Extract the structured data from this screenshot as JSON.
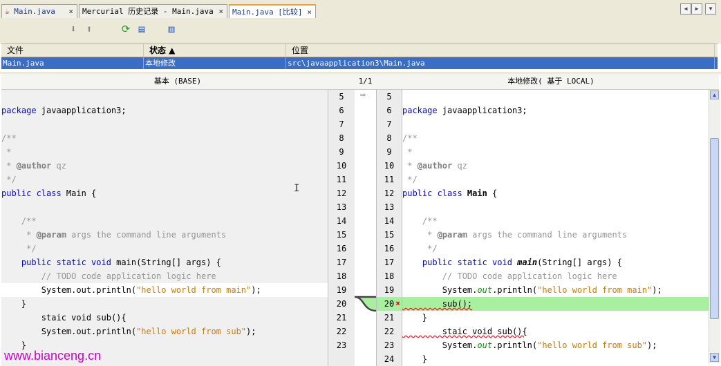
{
  "tabs": [
    {
      "label": "Main.java",
      "close": "×"
    },
    {
      "label": "Mercurial 历史记录 - Main.java",
      "close": "×"
    },
    {
      "label": "Main.java [比较]",
      "close": "×"
    }
  ],
  "table": {
    "headers": [
      "文件",
      "状态 ▲",
      "位置"
    ],
    "row": [
      "Main.java",
      "本地修改",
      "src\\javaapplication3\\Main.java"
    ]
  },
  "diff": {
    "left_title": "基本 (BASE)",
    "counter": "1/1",
    "right_title": "本地修改( 基于 LOCAL)",
    "left_numbers": [
      "5",
      "6",
      "7",
      "8",
      "9",
      "10",
      "11",
      "12",
      "13",
      "14",
      "15",
      "16",
      "17",
      "18",
      "19",
      "20",
      "21",
      "22",
      "23"
    ],
    "right_numbers": [
      "5",
      "6",
      "7",
      "8",
      "9",
      "10",
      "11",
      "12",
      "13",
      "14",
      "15",
      "16",
      "17",
      "18",
      "19",
      "20",
      "21",
      "22",
      "23",
      "24"
    ],
    "left_lines": {
      "l6a": "package",
      "l6b": " javaapplication3;",
      "l8": "/**",
      "l9": " *",
      "l10a": " * ",
      "l10b": "@author",
      "l10c": " qz",
      "l11": " */",
      "l12a": "public class",
      "l12b": " Main {",
      "l14": "    /**",
      "l15a": "     * ",
      "l15b": "@param",
      "l15c": " args the command line arguments",
      "l16": "     */",
      "l17a": "    public static void",
      "l17b": " main(String[] args) {",
      "l18": "        // TODO code application logic here",
      "l19a": "        System.out.println(",
      "l19b": "\"hello world from main\"",
      "l19c": ");",
      "l20": "    }",
      "l21": "        staic void sub(){",
      "l22a": "        System.out.println(",
      "l22b": "\"hello world from sub\"",
      "l22c": ");",
      "l23": "    }"
    },
    "right_lines": {
      "r6a": "package",
      "r6b": " javaapplication3;",
      "r8": "/**",
      "r9": " *",
      "r10a": " * ",
      "r10b": "@author",
      "r10c": " qz",
      "r11": " */",
      "r12a": "public class",
      "r12b": " Main",
      "r12c": " {",
      "r14": "    /**",
      "r15a": "     * ",
      "r15b": "@param",
      "r15c": " args the command line arguments",
      "r16": "     */",
      "r17a": "    public static void",
      "r17b": " main",
      "r17c": "(String[] args) {",
      "r18": "        // TODO code application logic here",
      "r19a": "        System.",
      "r19b": "out",
      "r19c": ".println(",
      "r19d": "\"hello world from main\"",
      "r19e": ");",
      "r20": "        sub();",
      "r21": "    }",
      "r22": "        staic void sub(){",
      "r23a": "        System.",
      "r23b": "out",
      "r23c": ".println(",
      "r23d": "\"hello world from sub\"",
      "r23e": ");",
      "r24": "    }"
    }
  },
  "watermark": "www.bianceng.cn",
  "colors": {
    "added": "#a8f0a0",
    "selection": "#3a6ec4",
    "keyword": "#0000e6"
  }
}
